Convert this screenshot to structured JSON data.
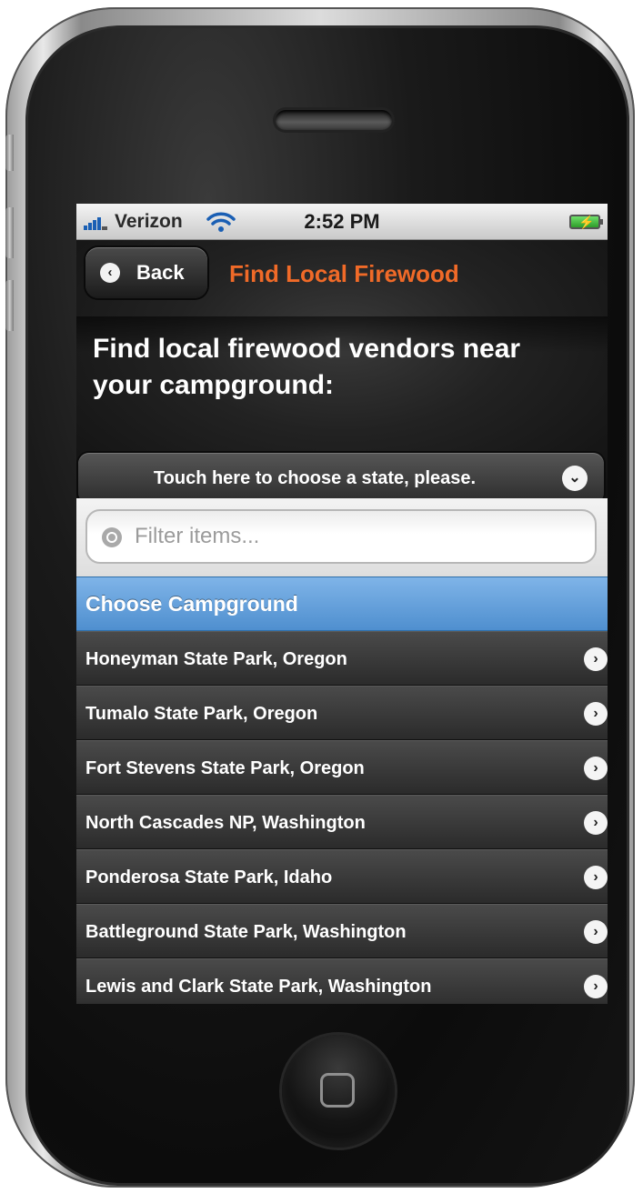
{
  "status_bar": {
    "carrier": "Verizon",
    "time": "2:52 PM",
    "signal_icon": "signal-bars-icon",
    "wifi_icon": "wifi-icon",
    "battery_icon": "battery-charging-icon"
  },
  "header": {
    "back_label": "Back",
    "title": "Find Local Firewood",
    "intro": "Find local firewood vendors near your campground:",
    "state_select_label": "Touch here to choose a state, please."
  },
  "filter": {
    "placeholder": "Filter items..."
  },
  "list": {
    "divider": "Choose Campground",
    "items": [
      {
        "label": "Honeyman State Park, Oregon"
      },
      {
        "label": "Tumalo State Park, Oregon"
      },
      {
        "label": "Fort Stevens State Park, Oregon"
      },
      {
        "label": "North Cascades NP, Washington"
      },
      {
        "label": "Ponderosa State Park, Idaho"
      },
      {
        "label": "Battleground State Park, Washington"
      },
      {
        "label": "Lewis and Clark State Park, Washington"
      }
    ]
  },
  "colors": {
    "title_accent": "#f06a28",
    "divider_blue": "#5b9bd8"
  }
}
